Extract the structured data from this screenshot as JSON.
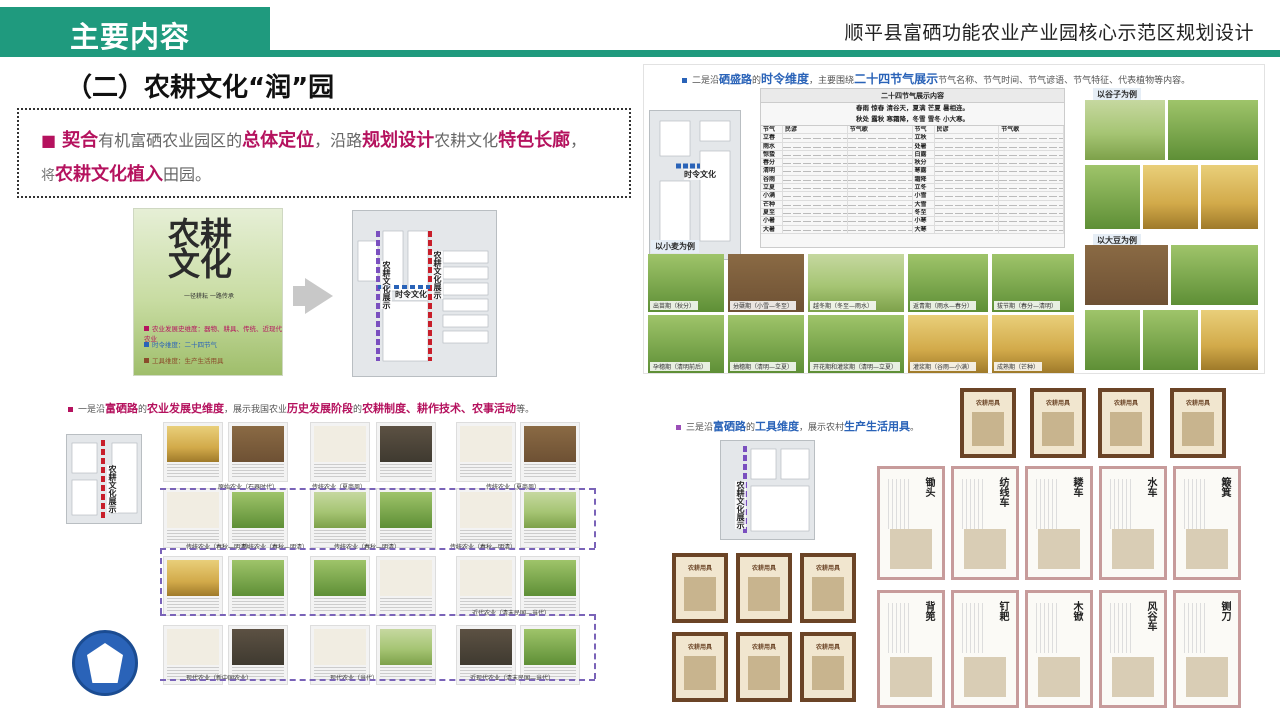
{
  "header": {
    "tab_title": "主要内容",
    "project_title": "顺平县富硒功能农业产业园核心示范区规划设计",
    "accent_color": "#1f9a7e"
  },
  "section": {
    "title": "（二）农耕文化“润”园"
  },
  "intro": {
    "p1_em1": "契合",
    "p1_t1": "有机富硒农业园区的",
    "p1_em2": "总体定位",
    "p1_t2": "，沿路",
    "p1_em3": "规划设计",
    "p1_t3": "农耕文化",
    "p1_em4": "特色长廊",
    "p1_t4": "，",
    "p2_t1": "将",
    "p2_em1": "农耕文化植入",
    "p2_t2": "田园。",
    "highlight_color": "#b5125e"
  },
  "poster": {
    "title": "农耕文化",
    "subtitle": "一径耕耘 一路传承",
    "legend": [
      "农业发展史维度：器物、耕具、传统、近现代农业",
      "时令维度：二十四节气",
      "工具维度：生产生活用具"
    ]
  },
  "map_labels": {
    "corridor": "农耕文化展示",
    "timeline": "时令文化",
    "display": "农耕文化展示"
  },
  "solar_panel": {
    "caption_prefix": "二是沿",
    "caption_road": "硒盛路",
    "caption_mid": "的",
    "caption_dim": "时令维度",
    "caption_t2": "，主要围绕",
    "caption_em": "二十四节气展示",
    "caption_tail": "节气名称、节气时间、节气谚语、节气特征、代表植物等内容。",
    "table_title": "二十四节气展示内容",
    "poem": [
      "春雨 惊春 清谷天，夏满 芒夏 暑相连。",
      "秋处 露秋 寒霜降，冬雪 雪冬 小大寒。"
    ],
    "headers": [
      "节气",
      "民谚",
      "节气歌",
      "节气",
      "民谚",
      "节气歌"
    ],
    "left_terms": [
      "立春",
      "雨水",
      "惊蛰",
      "春分",
      "清明",
      "谷雨",
      "立夏",
      "小满",
      "芒种",
      "夏至",
      "小暑",
      "大暑"
    ],
    "right_terms": [
      "立秋",
      "处暑",
      "白露",
      "秋分",
      "寒露",
      "霜降",
      "立冬",
      "小雪",
      "大雪",
      "冬至",
      "小寒",
      "大寒"
    ],
    "wheat_label": "以小麦为例",
    "grain_label": "以谷子为例",
    "soy_label": "以大豆为例",
    "wheat_stages_top": [
      "出苗期（秋分）",
      "分蘖期（小雪—冬至）",
      "越冬期（冬至—雨水）",
      "返青期（雨水—春分）",
      "拔节期（春分—清明）"
    ],
    "wheat_stages_bottom": [
      "孕穗期（清明前后）",
      "抽穗期（清明—立夏）",
      "开花期和灌浆期（清明—立夏）",
      "灌浆期（谷雨—小满）",
      "成熟期（芒种）"
    ]
  },
  "history_panel": {
    "caption_prefix": "一是沿",
    "caption_road": "富硒路",
    "caption_mid": "的",
    "caption_dim": "农业发展史维度",
    "caption_t2": "，展示我国农业",
    "caption_em1": "历史发展阶段",
    "caption_t3": "的",
    "caption_em2": "农耕制度、耕作技术、农事活动",
    "caption_tail": "等。",
    "eras": [
      "原始农业（石器时代）",
      "传统农业（夏商周）",
      "传统农业（夏商周）",
      "传统农业（春秋—明清）",
      "传统农业（春秋—明清）",
      "传统农业（春秋—明清）",
      "传统农业（春秋—明清）",
      "近代农业（清末民国—当代）",
      "现代农业（新中国农业）",
      "现代农业（当代）",
      "近现代农业（清末民国—当代）"
    ]
  },
  "tools_panel": {
    "caption_prefix": "三是沿",
    "caption_road": "富硒路",
    "caption_mid": "的",
    "caption_dim": "工具维度",
    "caption_t2": "，展示农村",
    "caption_em": "生产生活用具",
    "caption_tail": "。",
    "frame_title": "农耕用具",
    "tools_top": [
      "锄头",
      "纺线车",
      "耧车",
      "水车",
      "簸箕"
    ],
    "tools_bottom": [
      "背篼",
      "钉耙",
      "木锨",
      "风谷车",
      "铡刀"
    ]
  }
}
